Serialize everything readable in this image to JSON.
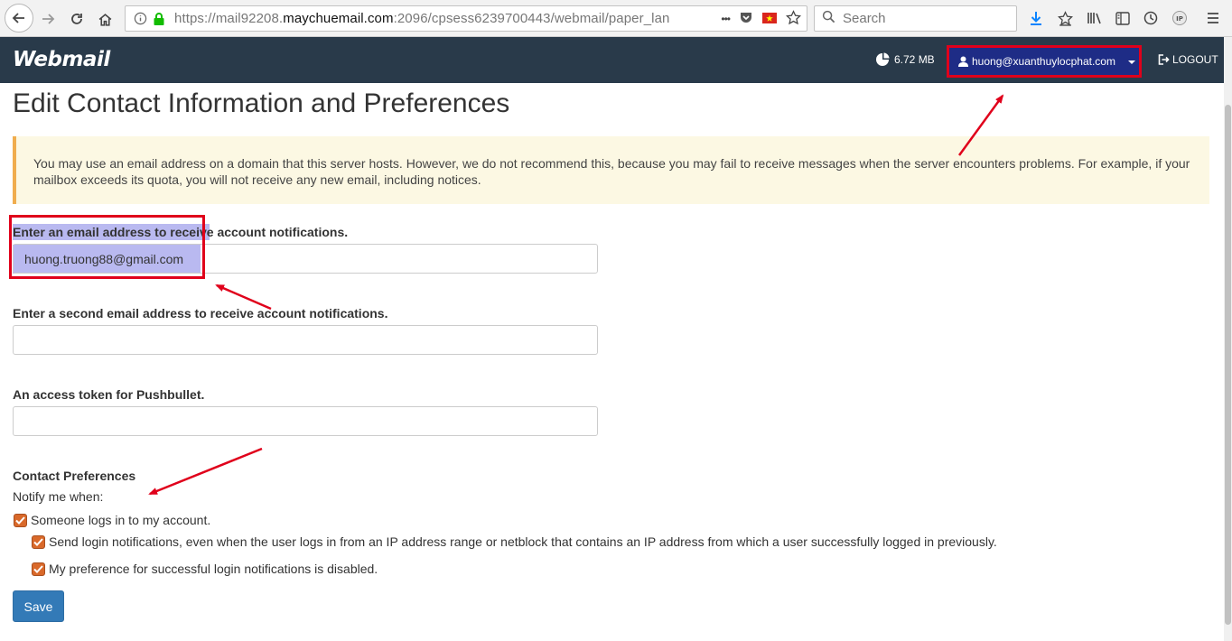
{
  "browser": {
    "url_prefix": "https://mail92208.",
    "url_domain": "maychuemail.com",
    "url_suffix": ":2096/cpsess6239700443/webmail/paper_lan",
    "search_placeholder": "Search",
    "more_label": "•••"
  },
  "header": {
    "logo": "Webmail",
    "quota": "6.72 MB",
    "user": "huong@xuanthuylocphat.com",
    "logout": "LOGOUT"
  },
  "page": {
    "title": "Edit Contact Information and Preferences",
    "alert": "You may use an email address on a domain that this server hosts. However, we do not recommend this, because you may fail to receive messages when the server encounters problems. For example, if your mailbox exceeds its quota, you will not receive any new email, including notices."
  },
  "fields": [
    {
      "label": "Enter an email address to receive account notifications.",
      "value": "huong.truong88@gmail.com",
      "placeholder": ""
    },
    {
      "label": "Enter a second email address to receive account notifications.",
      "value": "",
      "placeholder": ""
    },
    {
      "label": "An access token for Pushbullet.",
      "value": "",
      "placeholder": ""
    }
  ],
  "preferences": {
    "title": "Contact Preferences",
    "subtitle": "Notify me when:",
    "items": [
      {
        "label": "Someone logs in to my account.",
        "checked": true
      },
      {
        "label": "Send login notifications, even when the user logs in from an IP address range or netblock that contains an IP address from which a user successfully logged in previously.",
        "checked": true
      },
      {
        "label": "My preference for successful login notifications is disabled.",
        "checked": true
      }
    ]
  },
  "save_label": "Save",
  "colors": {
    "header_bg": "#293a4a",
    "user_menu_bg": "#1e2c86",
    "annotation_red": "#e0001b",
    "checkbox_orange": "#d9692a",
    "save_blue": "#337ab7",
    "alert_bg": "#fcf8e3"
  }
}
